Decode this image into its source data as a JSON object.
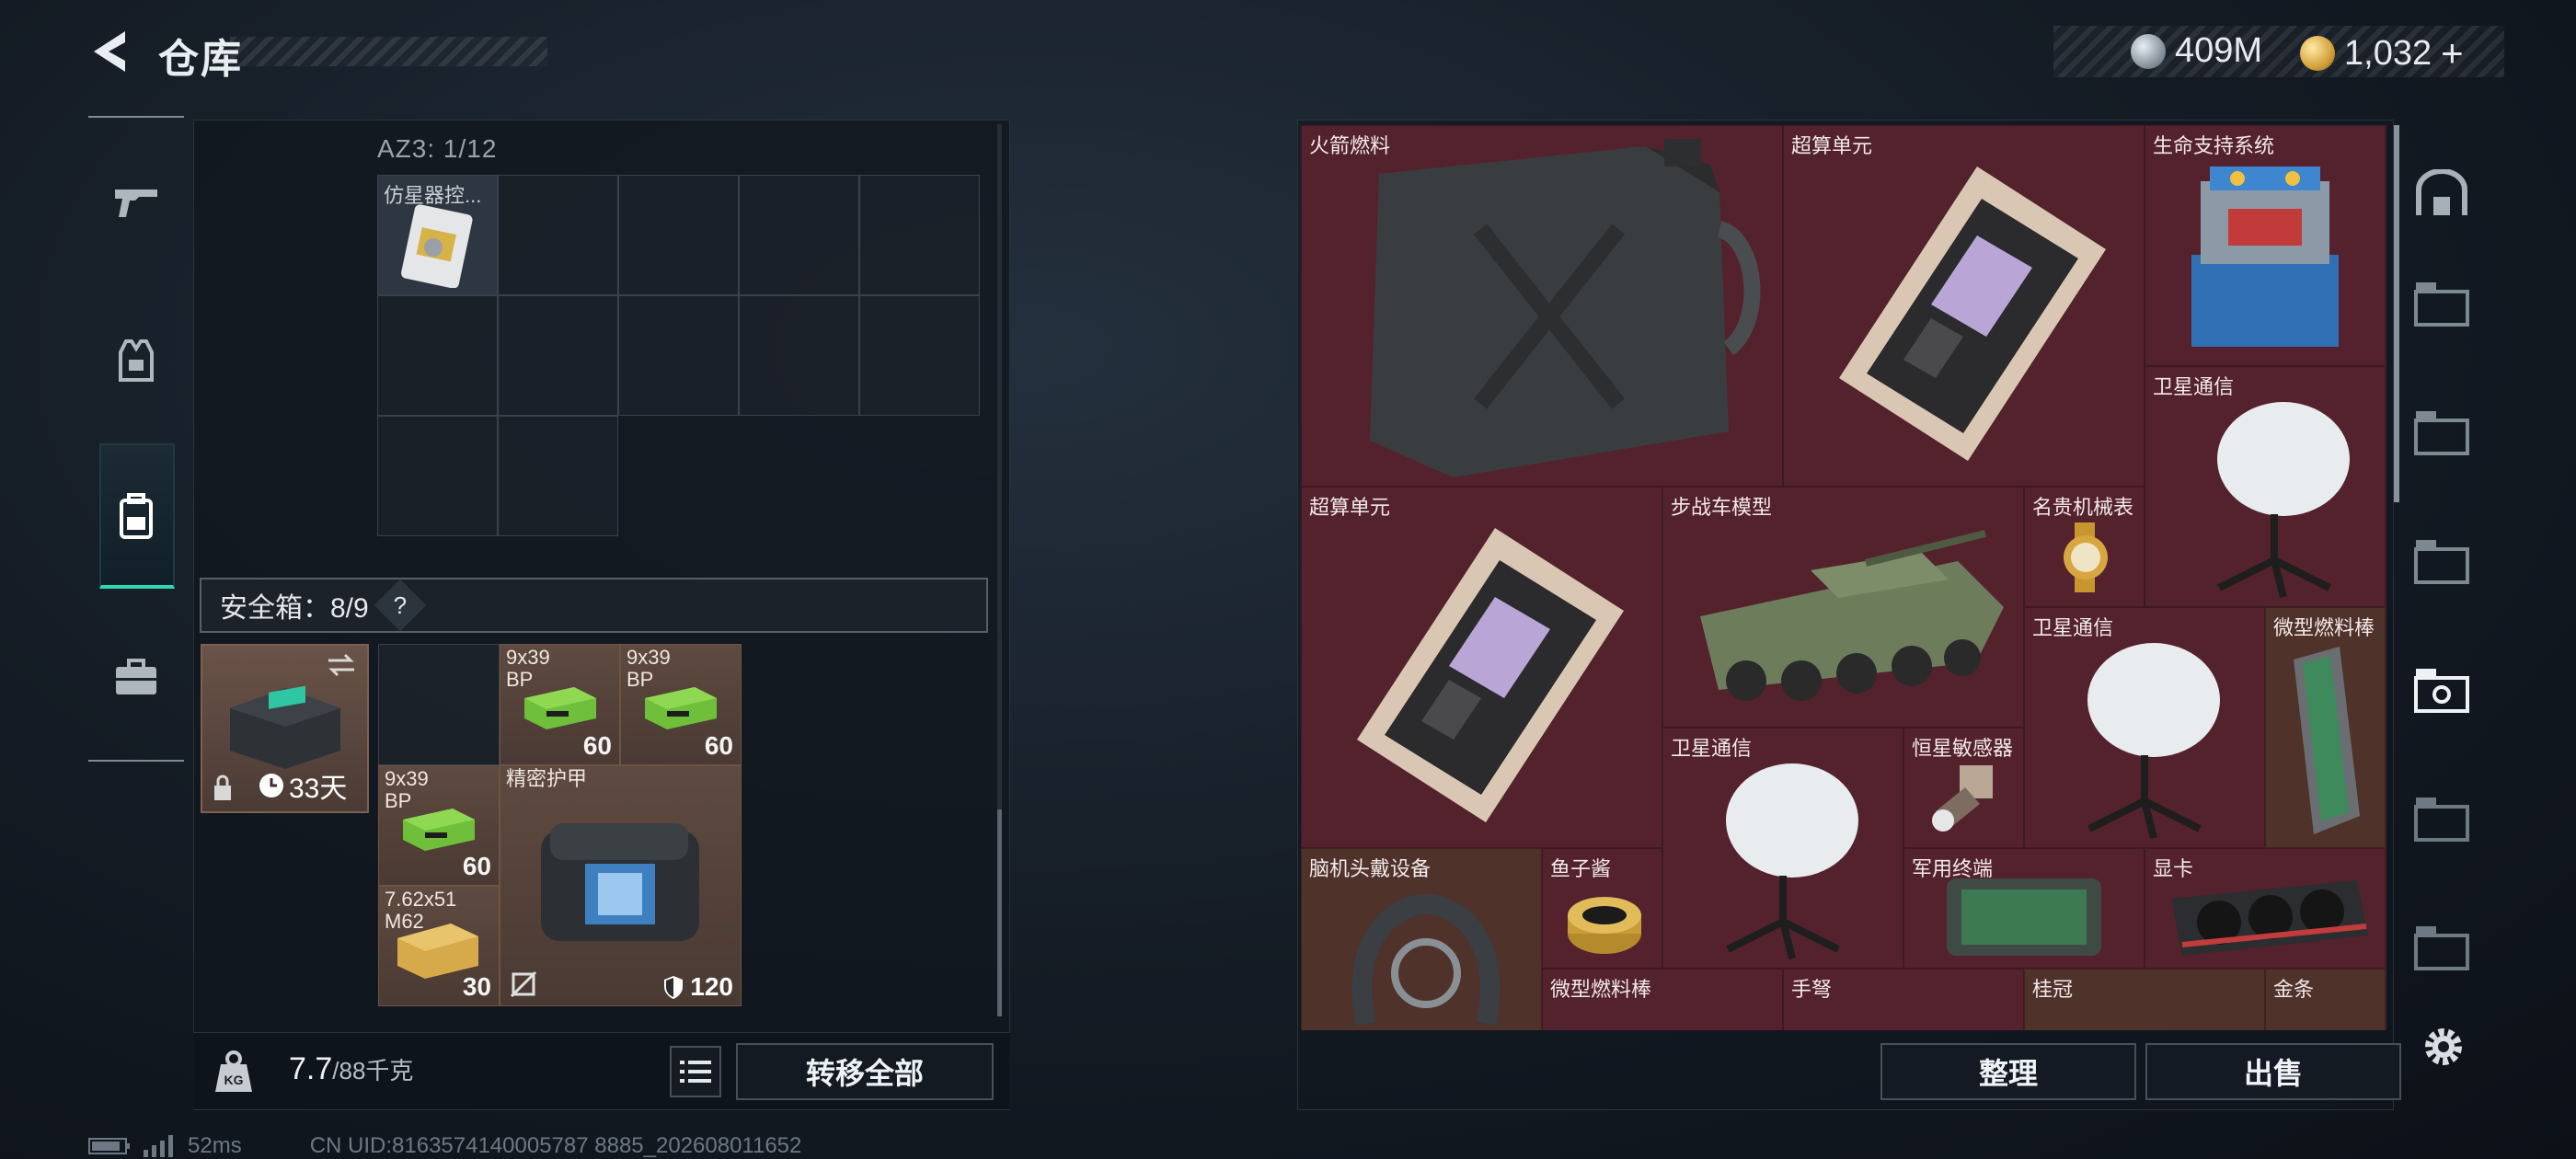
{
  "header": {
    "title": "仓库",
    "currency": [
      {
        "icon": "silver-coin-icon",
        "value": "409M"
      },
      {
        "icon": "gold-coin-icon",
        "value": "1,032",
        "plus": "+"
      }
    ]
  },
  "left_rail": [
    {
      "name": "weapons-tab",
      "icon": "gun-icon"
    },
    {
      "name": "armor-tab",
      "icon": "vest-icon"
    },
    {
      "name": "backpack-tab",
      "icon": "backpack-icon",
      "active": true
    },
    {
      "name": "case-tab",
      "icon": "briefcase-icon"
    }
  ],
  "container": {
    "label": "AZ3: 1/12",
    "items": [
      {
        "label": "仿星器控..."
      }
    ]
  },
  "safe_box": {
    "label": "安全箱：8/9",
    "help": "?",
    "case_days": "33天",
    "items": [
      {
        "label": "9x39\nBP",
        "qty": "60"
      },
      {
        "label": "9x39\nBP",
        "qty": "60"
      },
      {
        "label": "9x39\nBP",
        "qty": "60"
      },
      {
        "label": "7.62x51\nM62",
        "qty": "30"
      },
      {
        "label": "精密护甲",
        "durability": "120"
      }
    ]
  },
  "footer_left": {
    "weight_current": "7.7",
    "weight_max": "/88千克",
    "kg_label": "KG",
    "transfer_all": "转移全部"
  },
  "stash": {
    "items": [
      {
        "label": "火箭燃料",
        "key": "rocket-fuel"
      },
      {
        "label": "超算单元",
        "key": "supercomputer-1"
      },
      {
        "label": "生命支持系统",
        "key": "life-support"
      },
      {
        "label": "卫星通信",
        "key": "satcom-1"
      },
      {
        "label": "超算单元",
        "key": "supercomputer-2"
      },
      {
        "label": "步战车模型",
        "key": "ifv-model"
      },
      {
        "label": "名贵机械表",
        "key": "watch"
      },
      {
        "label": "卫星通信",
        "key": "satcom-2"
      },
      {
        "label": "微型燃料棒",
        "key": "fuel-rod-1"
      },
      {
        "label": "卫星通信",
        "key": "satcom-3"
      },
      {
        "label": "恒星敏感器",
        "key": "star-sensor"
      },
      {
        "label": "脑机头戴设备",
        "key": "bci-headset"
      },
      {
        "label": "鱼子酱",
        "key": "caviar"
      },
      {
        "label": "军用终端",
        "key": "mil-terminal"
      },
      {
        "label": "显卡",
        "key": "gpu"
      },
      {
        "label": "微型燃料棒",
        "key": "fuel-rod-2"
      },
      {
        "label": "手弩",
        "key": "hand-crossbow"
      },
      {
        "label": "桂冠",
        "key": "laurel"
      },
      {
        "label": "金条",
        "key": "gold-bar"
      }
    ]
  },
  "footer_right": {
    "organize": "整理",
    "sell": "出售"
  },
  "status": {
    "ping": "52ms",
    "uid": "CN UID:8163574140005787 8885_202608011652"
  },
  "colors": {
    "accent": "#2fd7b6",
    "stash_bg": "#4a1f2a",
    "safe_bg": "#5e4a40"
  }
}
